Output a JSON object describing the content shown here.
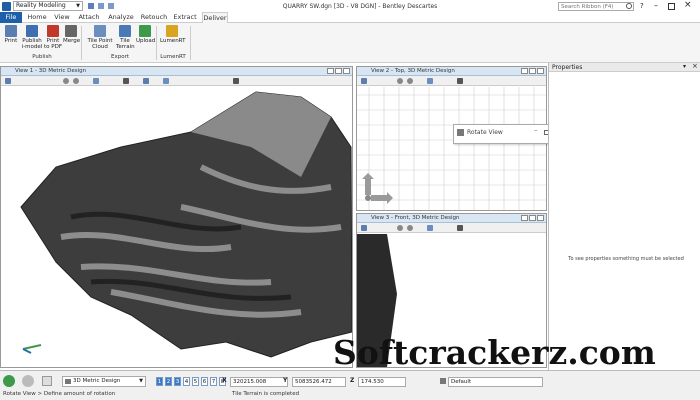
{
  "title_bar": {
    "app_selector": "Reality Modeling",
    "title": "QUARRY SW.dgn [3D - V8 DGN] - Bentley Descartes",
    "search_placeholder": "Search Ribbon (F4)"
  },
  "tabs": [
    "File",
    "Home",
    "View",
    "Attach",
    "Analyze",
    "Retouch",
    "Extract",
    "Deliver"
  ],
  "ribbon": {
    "publish_buttons": [
      {
        "label": "Print"
      },
      {
        "label": "Publish i-model"
      },
      {
        "label": "Print to PDF"
      },
      {
        "label": "Merge"
      }
    ],
    "export_buttons": [
      {
        "label": "Tile Point Cloud"
      },
      {
        "label": "Tile Terrain"
      },
      {
        "label": "Upload"
      }
    ],
    "lumenrt_button": "LumenRT",
    "groups": [
      "Publish",
      "Export",
      "LumenRT"
    ]
  },
  "views": {
    "view1": "View 1 - 3D Metric Design",
    "view2": "View 2 - Top, 3D Metric Design",
    "view3": "View 3 - Front, 3D Metric Design"
  },
  "rotate_dialog": {
    "title": "Rotate View"
  },
  "properties": {
    "title": "Properties",
    "empty_message": "To see properties something must be selected"
  },
  "bottom_bar": {
    "level": "3D Metric Design",
    "view_numbers": [
      "1",
      "2",
      "3",
      "4",
      "5",
      "6",
      "7",
      "8"
    ],
    "x_label": "X",
    "x_value": "320215.008",
    "y_label": "Y",
    "y_value": "5083526.472",
    "z_label": "Z",
    "z_value": "174.530",
    "active_level": "Default",
    "status_left": "Rotate View > Define amount of rotation",
    "status_right": "Tile Terrain is completed"
  },
  "watermark": "Softcrackerz.com",
  "colors": {
    "file_tab": "#1e5fa8",
    "accent": "#2b6cb0"
  }
}
